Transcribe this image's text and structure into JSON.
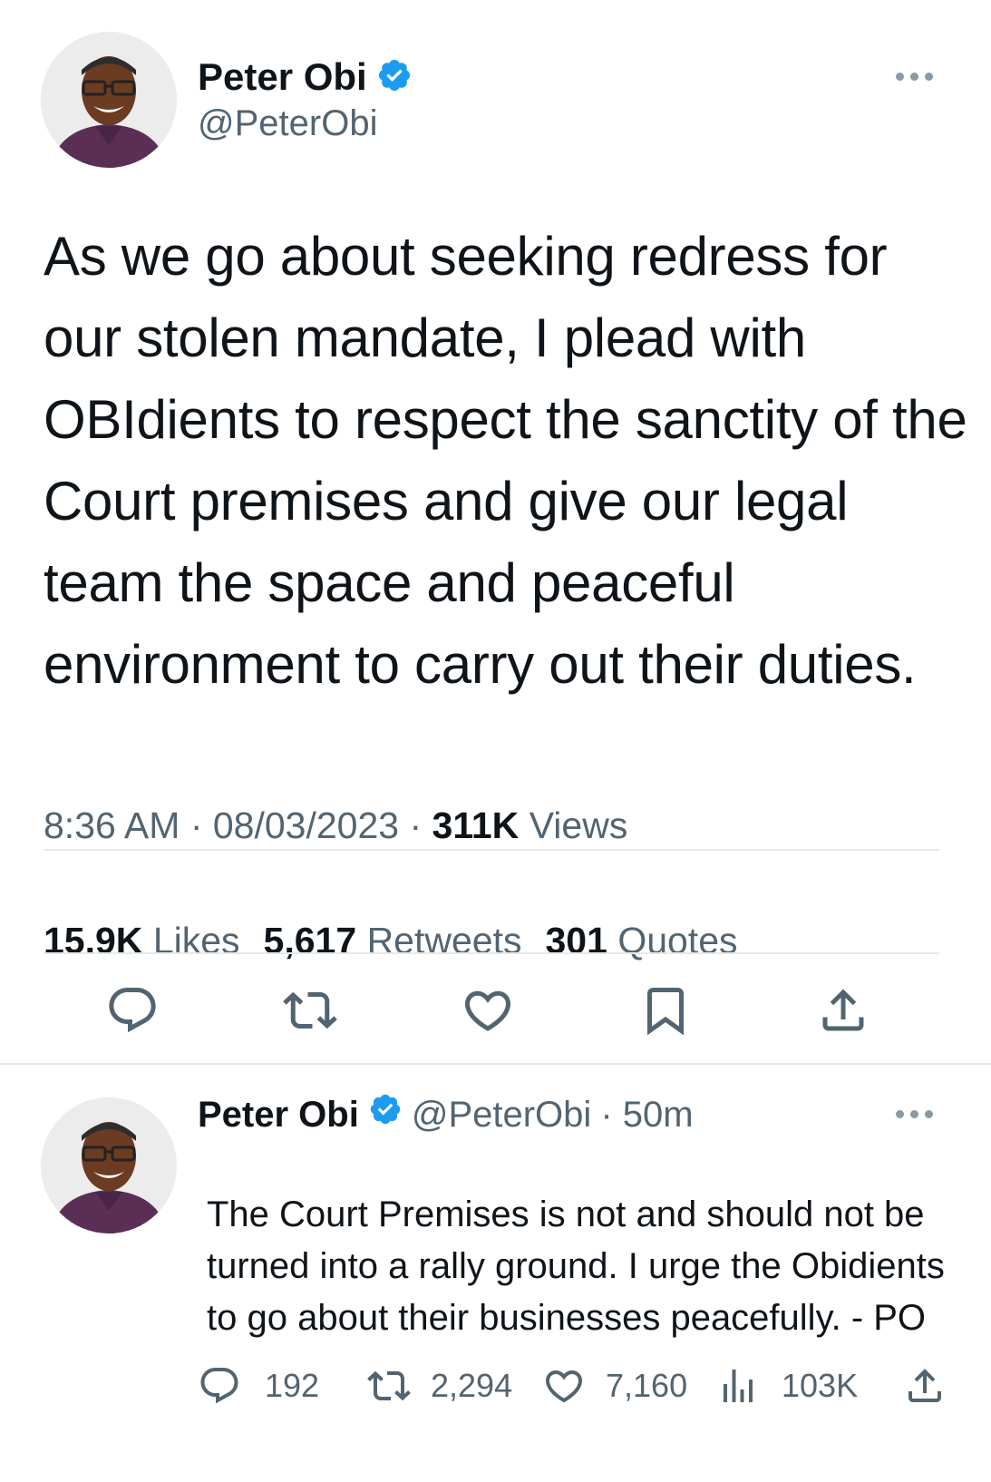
{
  "main_tweet": {
    "author_name": "Peter Obi",
    "handle": "@PeterObi",
    "text": "As we go about seeking redress for our stolen mandate, I plead with OBIdients to respect the sanctity of the Court premises and give our legal team the space and peaceful environment to carry out their duties.",
    "time": "8:36 AM",
    "sep": " · ",
    "date": "08/03/2023",
    "views_count": "311K",
    "views_label": "Views",
    "likes_count": "15.9K",
    "likes_label": "Likes",
    "retweets_count": "5,617",
    "retweets_label": "Retweets",
    "quotes_count": "301",
    "quotes_label": "Quotes"
  },
  "reply_tweet": {
    "author_name": "Peter Obi",
    "handle": "@PeterObi",
    "age": "· 50m",
    "text": "The Court Premises is not and should not be turned into a rally ground. I urge the Obidients to go about their businesses peacefully.  - PO",
    "replies": "192",
    "retweets": "2,294",
    "likes": "7,160",
    "views": "103K"
  },
  "icons": {
    "verified": "verified-badge-icon",
    "more": "more-dots-icon",
    "reply": "reply-bubble-icon",
    "retweet": "retweet-icon",
    "like": "heart-icon",
    "bookmark": "bookmark-icon",
    "share": "share-upload-icon",
    "views": "views-bars-icon"
  },
  "colors": {
    "verified": "#1d9bf0",
    "text": "#0f1419",
    "secondary": "#536471",
    "divider": "#e6e9eb"
  }
}
